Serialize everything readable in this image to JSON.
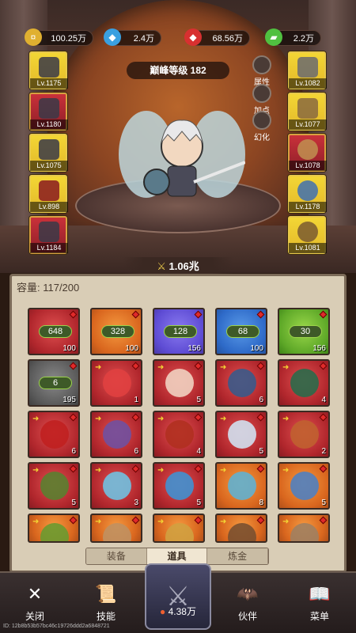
{
  "currency": [
    {
      "name": "gold",
      "value": "100.25万",
      "color": "#e0b030",
      "icon": "coin-icon"
    },
    {
      "name": "crystal",
      "value": "2.4万",
      "color": "#3aa0e0",
      "icon": "blue-gem-icon"
    },
    {
      "name": "ruby",
      "value": "68.56万",
      "color": "#d83030",
      "icon": "red-gem-icon"
    },
    {
      "name": "jade",
      "value": "2.2万",
      "color": "#50c040",
      "icon": "green-jade-icon"
    }
  ],
  "peak_level": "巅峰等级 182",
  "side_buttons": [
    "属性",
    "加点",
    "幻化"
  ],
  "left_slots": [
    {
      "level": "Lv.1175",
      "color": "yellow",
      "icon": "helmet-icon"
    },
    {
      "level": "Lv.1180",
      "color": "red",
      "icon": "armor-icon"
    },
    {
      "level": "Lv.1075",
      "color": "yellow",
      "icon": "pants-icon"
    },
    {
      "level": "Lv.898",
      "color": "yellow",
      "icon": "boots-icon"
    },
    {
      "level": "Lv.1184",
      "color": "red",
      "icon": "glove-icon"
    }
  ],
  "right_slots": [
    {
      "level": "Lv.1082",
      "color": "yellow",
      "icon": "spear-icon"
    },
    {
      "level": "Lv.1077",
      "color": "yellow",
      "icon": "shield-icon"
    },
    {
      "level": "Lv.1078",
      "color": "red",
      "icon": "ring-icon"
    },
    {
      "level": "Lv.1178",
      "color": "yellow",
      "icon": "necklace-icon"
    },
    {
      "level": "Lv.1081",
      "color": "yellow",
      "icon": "amulet-icon"
    }
  ],
  "power": "1.06兆",
  "capacity": "容量: 117/200",
  "items": [
    {
      "color": "red",
      "chip": "648",
      "count": "100",
      "badge": true
    },
    {
      "color": "orange",
      "chip": "328",
      "count": "100",
      "badge": true
    },
    {
      "color": "purple",
      "chip": "128",
      "count": "156",
      "badge": true
    },
    {
      "color": "blue",
      "chip": "68",
      "count": "100",
      "badge": true
    },
    {
      "color": "green",
      "chip": "30",
      "count": "156",
      "badge": true
    },
    {
      "color": "gray",
      "chip": "6",
      "count": "195",
      "badge": true
    },
    {
      "color": "red",
      "mon": "#e04040",
      "count": "1",
      "badge": true
    },
    {
      "color": "red",
      "mon": "#f0d0c0",
      "count": "5",
      "badge": true
    },
    {
      "color": "red",
      "mon": "#3a5a8a",
      "count": "6",
      "badge": true
    },
    {
      "color": "red",
      "mon": "#2a6a4a",
      "count": "4",
      "badge": true
    },
    {
      "color": "red",
      "mon": "#c02020",
      "count": "6",
      "badge": true
    },
    {
      "color": "red",
      "mon": "#7050a0",
      "count": "6",
      "badge": true
    },
    {
      "color": "red",
      "mon": "#b03020",
      "count": "4",
      "badge": true
    },
    {
      "color": "red",
      "mon": "#d0e0f0",
      "count": "5",
      "badge": true
    },
    {
      "color": "red",
      "mon": "#c06030",
      "count": "2",
      "badge": true
    },
    {
      "color": "red",
      "mon": "#5a8030",
      "count": "5",
      "badge": true
    },
    {
      "color": "red",
      "mon": "#70c0e0",
      "count": "3",
      "badge": true
    },
    {
      "color": "red",
      "mon": "#4090d0",
      "count": "5",
      "badge": true
    },
    {
      "color": "orange",
      "mon": "#60b0d0",
      "count": "8",
      "badge": true
    },
    {
      "color": "orange",
      "mon": "#5080c0",
      "count": "5",
      "badge": true
    },
    {
      "color": "orange",
      "mon": "#6a9a30",
      "count": "",
      "badge": true
    },
    {
      "color": "orange",
      "mon": "#c09060",
      "count": "",
      "badge": true
    },
    {
      "color": "orange",
      "mon": "#d0a040",
      "count": "",
      "badge": true
    },
    {
      "color": "orange",
      "mon": "#7a5030",
      "count": "",
      "badge": true
    },
    {
      "color": "orange",
      "mon": "#a08060",
      "count": "",
      "badge": true
    }
  ],
  "tabs": [
    "装备",
    "道具",
    "炼金"
  ],
  "active_tab": "道具",
  "nav": [
    {
      "label": "关闭",
      "icon": "close-icon",
      "glyph": "✕"
    },
    {
      "label": "技能",
      "icon": "scroll-icon",
      "glyph": "📜"
    },
    {
      "label": "伙伴",
      "icon": "wings-icon",
      "glyph": "🦇"
    },
    {
      "label": "菜单",
      "icon": "book-icon",
      "glyph": "📖"
    }
  ],
  "battle_value": "4.38万",
  "uid": "ID: 12b8b53b57bc46c19726ddd2a6848721"
}
